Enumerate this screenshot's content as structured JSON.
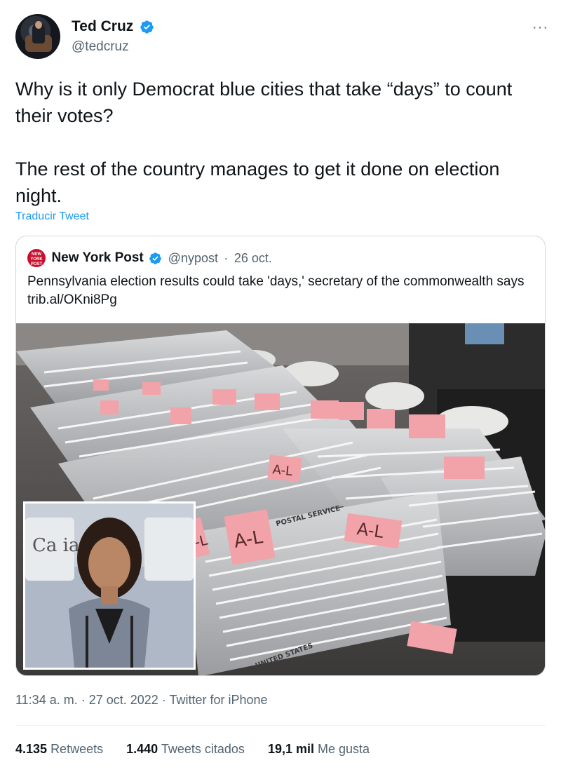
{
  "author": {
    "name": "Ted Cruz",
    "handle": "@tedcruz",
    "more_label": "···"
  },
  "tweet": {
    "paragraphs": [
      "Why is it only Democrat blue cities that take “days” to count their votes?",
      "The rest of the country manages to get it done on election night."
    ],
    "translate_label": "Traducir Tweet"
  },
  "quote": {
    "logo_text": "NEW YORK POST",
    "name": "New York Post",
    "handle": "@nypost",
    "date": "26 oct.",
    "text": "Pennsylvania election results could take 'days,' secretary of the commonwealth says trib.al/OKni8Pg",
    "photo_signs": [
      "A-L",
      "A-L",
      "A-L",
      "A-L"
    ],
    "box_print": [
      "POSTAL SERVICE",
      "UNITED STATES"
    ],
    "inset_sign": "Ca ia Cer"
  },
  "meta": {
    "timestamp": "11:34 a. m. · 27 oct. 2022 · Twitter for iPhone"
  },
  "stats": {
    "retweets_count": "4.135",
    "retweets_label": "Retweets",
    "quotes_count": "1.440",
    "quotes_label": "Tweets citados",
    "likes_count": "19,1 mil",
    "likes_label": "Me gusta"
  },
  "colors": {
    "accent": "#1d9bf0",
    "secondary_text": "#536471",
    "nypost_red": "#c8102e"
  }
}
